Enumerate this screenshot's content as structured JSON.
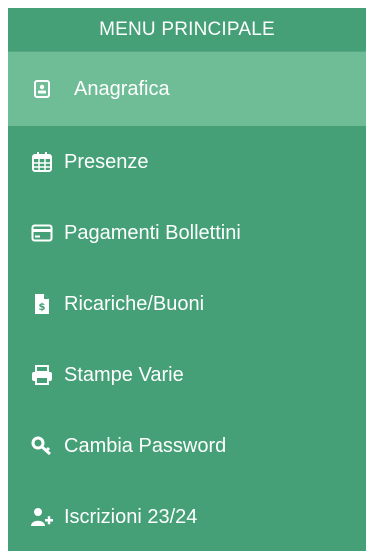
{
  "menu": {
    "title": "MENU PRINCIPALE",
    "items": [
      {
        "label": "Anagrafica",
        "icon": "id-badge-icon",
        "active": true
      },
      {
        "label": "Presenze",
        "icon": "calendar-icon"
      },
      {
        "label": "Pagamenti Bollettini",
        "icon": "credit-card-icon"
      },
      {
        "label": "Ricariche/Buoni",
        "icon": "invoice-dollar-icon"
      },
      {
        "label": "Stampe Varie",
        "icon": "printer-icon"
      },
      {
        "label": "Cambia Password",
        "icon": "key-icon"
      },
      {
        "label": "Iscrizioni 23/24",
        "icon": "user-plus-icon"
      }
    ]
  },
  "colors": {
    "menu_background": "#45a077",
    "active_item_background": "#6fbd96",
    "text": "#ffffff"
  }
}
